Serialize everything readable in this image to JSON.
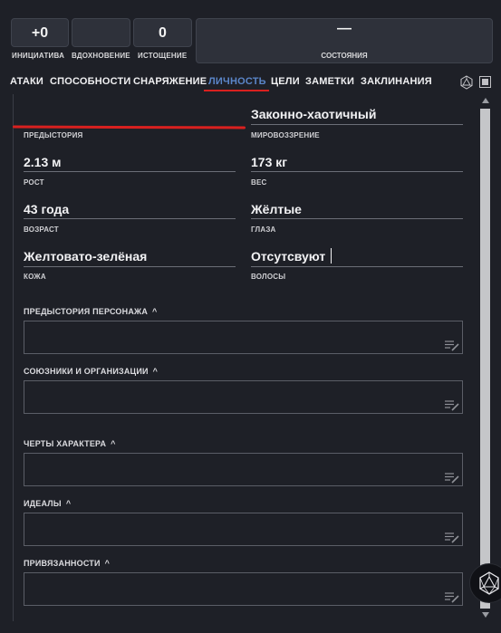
{
  "stats": {
    "initiative_value": "+0",
    "initiative_label": "ИНИЦИАТИВА",
    "inspiration_value": "",
    "inspiration_label": "ВДОХНОВЕНИЕ",
    "exhaustion_value": "0",
    "exhaustion_label": "ИСТОЩЕНИЕ",
    "conditions_value": "—",
    "conditions_label": "СОСТОЯНИЯ"
  },
  "tabs": [
    {
      "label": "АТАКИ",
      "active": false
    },
    {
      "label": "СПОСОБНОСТИ",
      "active": false
    },
    {
      "label": "СНАРЯЖЕНИЕ",
      "active": false
    },
    {
      "label": "ЛИЧНОСТЬ",
      "active": true
    },
    {
      "label": "ЦЕЛИ",
      "active": false
    },
    {
      "label": "ЗАМЕТКИ",
      "active": false
    },
    {
      "label": "ЗАКЛИНАНИЯ",
      "active": false
    }
  ],
  "fields": {
    "background": {
      "value": "",
      "label": "ПРЕДЫСТОРИЯ"
    },
    "alignment": {
      "value": "Законно-хаотичный",
      "label": "МИРОВОЗЗРЕНИЕ"
    },
    "height": {
      "value": "2.13 м",
      "label": "РОСТ"
    },
    "weight": {
      "value": "173 кг",
      "label": "ВЕС"
    },
    "age": {
      "value": "43 года",
      "label": "ВОЗРАСТ"
    },
    "eyes": {
      "value": "Жёлтые",
      "label": "ГЛАЗА"
    },
    "skin": {
      "value": "Желтовато-зелёная",
      "label": "КОЖА"
    },
    "hair": {
      "value": "Отсутсвуют",
      "label": "ВОЛОСЫ"
    }
  },
  "sections": [
    {
      "label": "ПРЕДЫСТОРИЯ ПЕРСОНАЖА",
      "value": ""
    },
    {
      "label": "СОЮЗНИКИ И ОРГАНИЗАЦИИ",
      "value": ""
    },
    {
      "label": "ЧЕРТЫ ХАРАКТЕРА",
      "value": ""
    },
    {
      "label": "ИДЕАЛЫ",
      "value": ""
    },
    {
      "label": "ПРИВЯЗАННОСТИ",
      "value": ""
    }
  ],
  "colors": {
    "background": "#1e2027",
    "active_tab": "#5b86c9",
    "accent_red": "#d9201f",
    "box": "#2e313a"
  },
  "icons": [
    "d20-icon",
    "square-toggle-icon",
    "edit-icon",
    "chevron-up-icon",
    "d20-roll-icon"
  ]
}
